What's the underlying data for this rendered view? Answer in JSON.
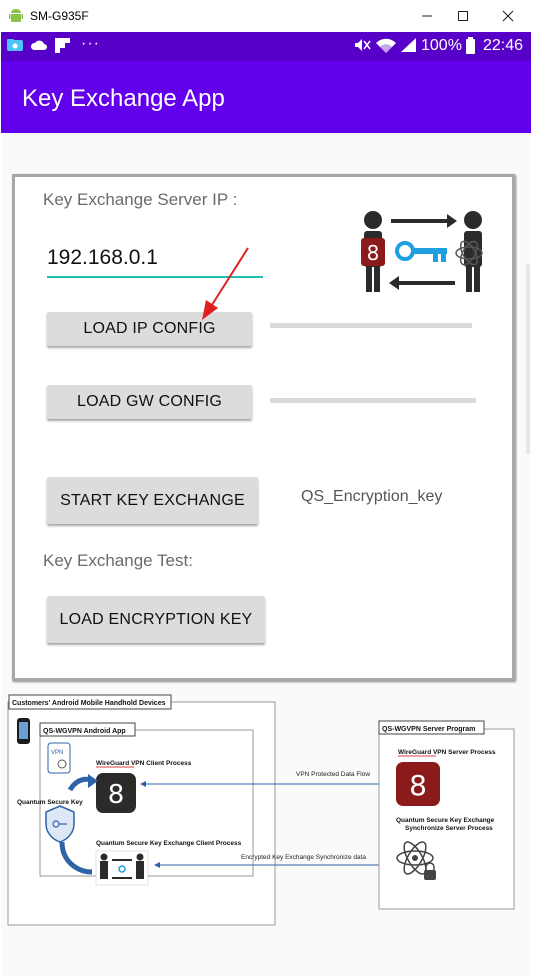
{
  "window": {
    "title": "SM-G935F",
    "minimize_icon": "minimize-icon",
    "maximize_icon": "maximize-icon",
    "close_icon": "close-icon"
  },
  "status": {
    "battery": "100%",
    "time": "22:46",
    "more": "···"
  },
  "appbar": {
    "title": "Key Exchange App"
  },
  "form": {
    "server_ip_label": "Key Exchange Server IP :",
    "server_ip_value": "192.168.0.1",
    "load_ip_button": "LOAD IP CONFIG",
    "load_gw_button": "LOAD GW CONFIG",
    "start_button": "START KEY EXCHANGE",
    "key_name": "QS_Encryption_key",
    "test_label": "Key Exchange Test:",
    "load_key_button": "LOAD ENCRYPTION KEY"
  },
  "diagram": {
    "devices_title": "Customers' Android Mobile Handhold Devices",
    "app_title": "QS-WGVPN Android App",
    "client_process": "WireGuard VPN Client Process",
    "quantum_key": "Quantum Secure Key",
    "key_client": "Quantum Secure Key Exchange Client Process",
    "vpn_flow": "VPN Protected Data Flow",
    "key_sync": "Encrypted Key Exchange Synchronize data",
    "server_title": "QS-WGVPN Server Program",
    "server_process": "WireGuard VPN Server Process",
    "key_server_1": "Quantum Secure Key Exchange",
    "key_server_2": "Synchronize Server  Process",
    "vpn_badge": "VPN"
  },
  "colors": {
    "appbar": "#6200ee",
    "statusbar": "#5600c8",
    "accent": "#1fbfb0",
    "wireguard": "#8b1a1a",
    "arrow": "#e02020"
  }
}
